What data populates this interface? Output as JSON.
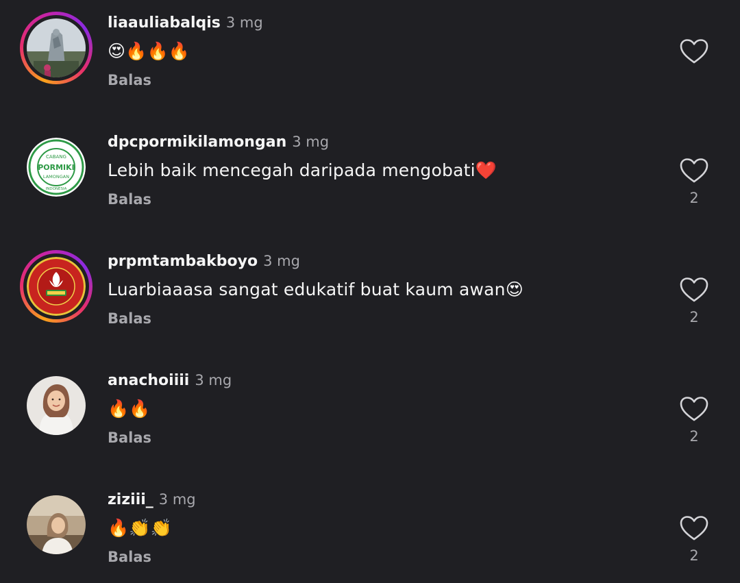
{
  "comments": [
    {
      "username": "liaauliabalqis",
      "time": "3 mg",
      "text": "😍🔥🔥🔥",
      "reply_label": "Balas",
      "like_count": ""
    },
    {
      "username": "dpcpormikilamongan",
      "time": "3 mg",
      "text": "Lebih baik mencegah daripada mengobati❤️",
      "reply_label": "Balas",
      "like_count": "2",
      "avatar_lettering": [
        "CABANG",
        "PORMIKI",
        "LAMONGAN",
        "INDONESIA"
      ]
    },
    {
      "username": "prpmtambakboyo",
      "time": "3 mg",
      "text": "Luarbiaaasa sangat edukatif buat kaum awan😍",
      "reply_label": "Balas",
      "like_count": "2"
    },
    {
      "username": "anachoiiii",
      "time": "3 mg",
      "text": "🔥🔥",
      "reply_label": "Balas",
      "like_count": "2"
    },
    {
      "username": "ziziii_",
      "time": "3 mg",
      "text": "🔥👏👏",
      "reply_label": "Balas",
      "like_count": "2"
    }
  ],
  "colors": {
    "background": "#1f1f23",
    "text": "#f5f5f5",
    "muted": "#a8a8ad",
    "story_ring_start": "#f9a21b",
    "story_ring_end": "#c423a8"
  },
  "icons": {
    "like": "heart-outline-icon"
  }
}
